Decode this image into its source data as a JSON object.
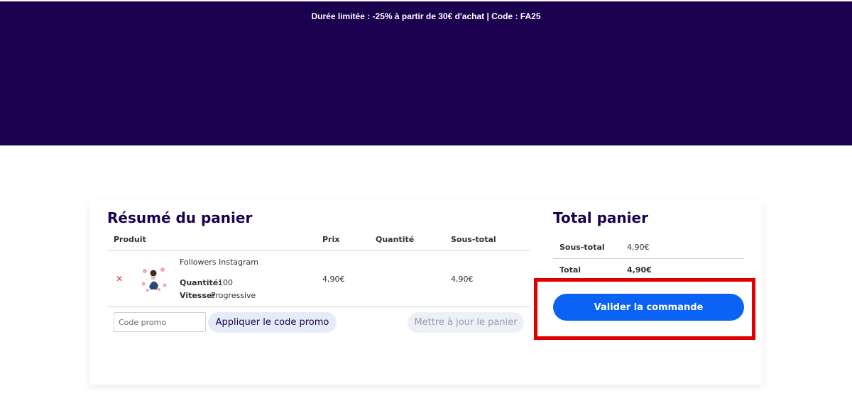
{
  "banner": {
    "text": "Durée limitée : -25% à partir de 30€ d'achat | Code : FA25"
  },
  "cart_summary": {
    "title": "Résumé du panier",
    "columns": [
      "Produit",
      "Prix",
      "Quantité",
      "Sous-total"
    ],
    "item": {
      "name": "Followers Instagram",
      "quantity_label": "Quantité:",
      "quantity_value": "100",
      "speed_label": "Vitesse:",
      "speed_value": "Progressive",
      "price": "4,90€",
      "subtotal": "4,90€"
    },
    "promo_placeholder": "Code promo",
    "apply_button": "Appliquer le code promo",
    "update_button": "Mettre à jour le panier"
  },
  "cart_totals": {
    "title": "Total panier",
    "subtotal_label": "Sous-total",
    "subtotal_value": "4,90€",
    "total_label": "Total",
    "total_value": "4,90€",
    "checkout_button": "Valider la commande"
  },
  "colors": {
    "banner_bg": "#1b0050",
    "primary_blue": "#0a63f5",
    "highlight_red": "#e00000",
    "remove_red": "#d32f2f"
  }
}
